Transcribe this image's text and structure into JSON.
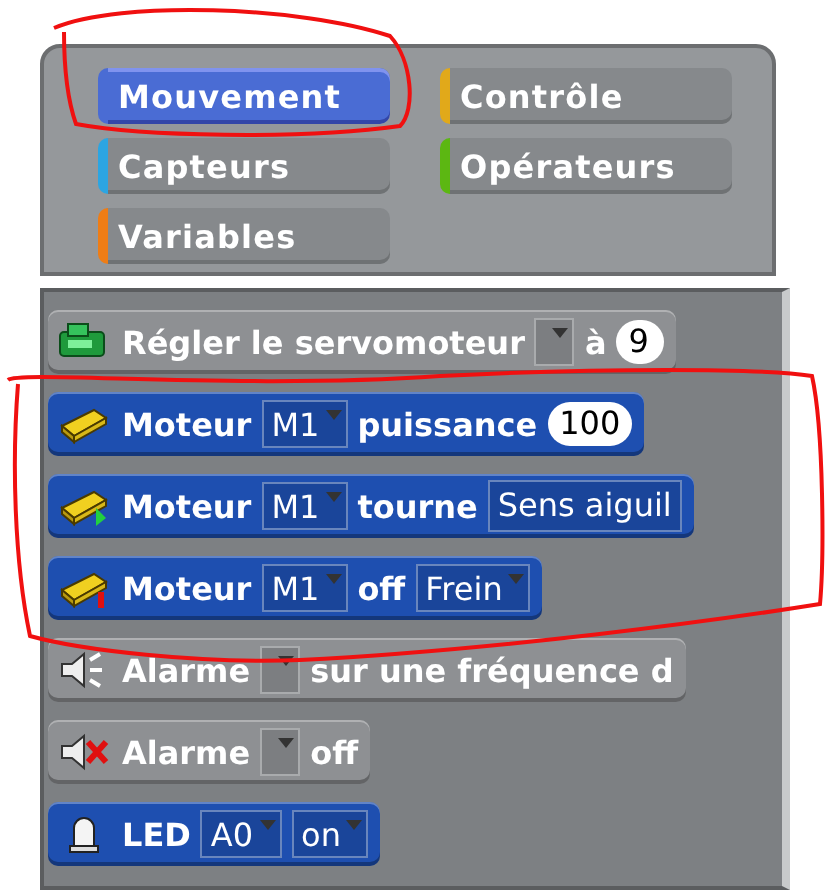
{
  "categories": [
    {
      "label": "Mouvement",
      "color": "#4a6cd4",
      "selected": true
    },
    {
      "label": "Contrôle",
      "color": "#e1a91a",
      "selected": false
    },
    {
      "label": "Capteurs",
      "color": "#2ca5e2",
      "selected": false
    },
    {
      "label": "Opérateurs",
      "color": "#5cb712",
      "selected": false
    },
    {
      "label": "Variables",
      "color": "#ee7d16",
      "selected": false
    }
  ],
  "blocks": [
    {
      "kind": "servo",
      "color": "#8e9093",
      "parts": [
        {
          "kind": "label",
          "text": "Régler le servomoteur"
        },
        {
          "kind": "dropdown"
        },
        {
          "kind": "label",
          "text": "à"
        },
        {
          "kind": "number",
          "text": "9"
        }
      ]
    },
    {
      "kind": "motor",
      "color": "#1e4fb0",
      "parts": [
        {
          "kind": "label",
          "text": "Moteur"
        },
        {
          "kind": "dropdown",
          "text": "M1"
        },
        {
          "kind": "label",
          "text": "puissance"
        },
        {
          "kind": "number",
          "text": "100"
        }
      ]
    },
    {
      "kind": "motor-turn",
      "color": "#1e4fb0",
      "parts": [
        {
          "kind": "label",
          "text": "Moteur"
        },
        {
          "kind": "dropdown",
          "text": "M1"
        },
        {
          "kind": "label",
          "text": "tourne"
        },
        {
          "kind": "field",
          "text": "Sens aiguil"
        }
      ]
    },
    {
      "kind": "motor-off",
      "color": "#1e4fb0",
      "parts": [
        {
          "kind": "label",
          "text": "Moteur"
        },
        {
          "kind": "dropdown",
          "text": "M1"
        },
        {
          "kind": "label",
          "text": "off"
        },
        {
          "kind": "dropdown",
          "text": "Frein"
        }
      ]
    },
    {
      "kind": "alarm",
      "color": "#8e9093",
      "parts": [
        {
          "kind": "label",
          "text": "Alarme"
        },
        {
          "kind": "dropdown"
        },
        {
          "kind": "label",
          "text": "sur une fréquence d"
        }
      ]
    },
    {
      "kind": "alarm-off",
      "color": "#8e9093",
      "parts": [
        {
          "kind": "label",
          "text": "Alarme"
        },
        {
          "kind": "dropdown"
        },
        {
          "kind": "label",
          "text": "off"
        }
      ]
    },
    {
      "kind": "led",
      "color": "#1e4fb0",
      "parts": [
        {
          "kind": "label",
          "text": "LED"
        },
        {
          "kind": "dropdown",
          "text": "A0"
        },
        {
          "kind": "dropdown",
          "text": "on"
        }
      ]
    }
  ],
  "annotations": {
    "circle_around_tab": true,
    "outline_around_blocks": true
  }
}
